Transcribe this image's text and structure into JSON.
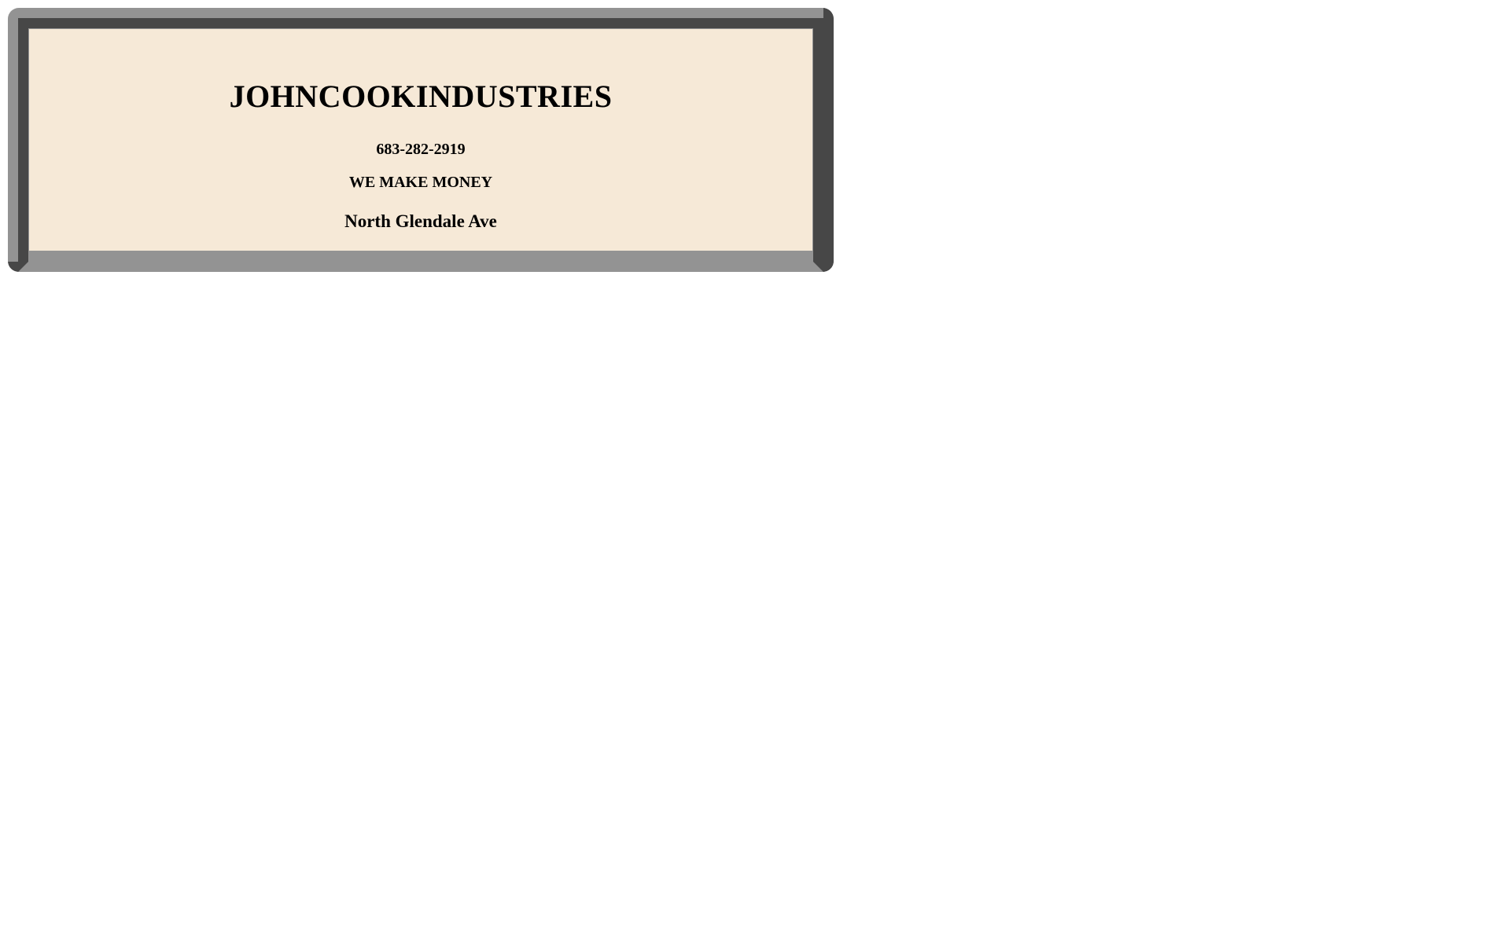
{
  "business_card": {
    "company_name": "JOHNCOOKINDUSTRIES",
    "phone": "683-282-2919",
    "tagline": "WE MAKE MONEY",
    "address": "North Glendale Ave"
  },
  "colors": {
    "card_background": "#f6e9d7",
    "frame_light": "#939393",
    "frame_dark": "#474747",
    "text": "#000000"
  }
}
